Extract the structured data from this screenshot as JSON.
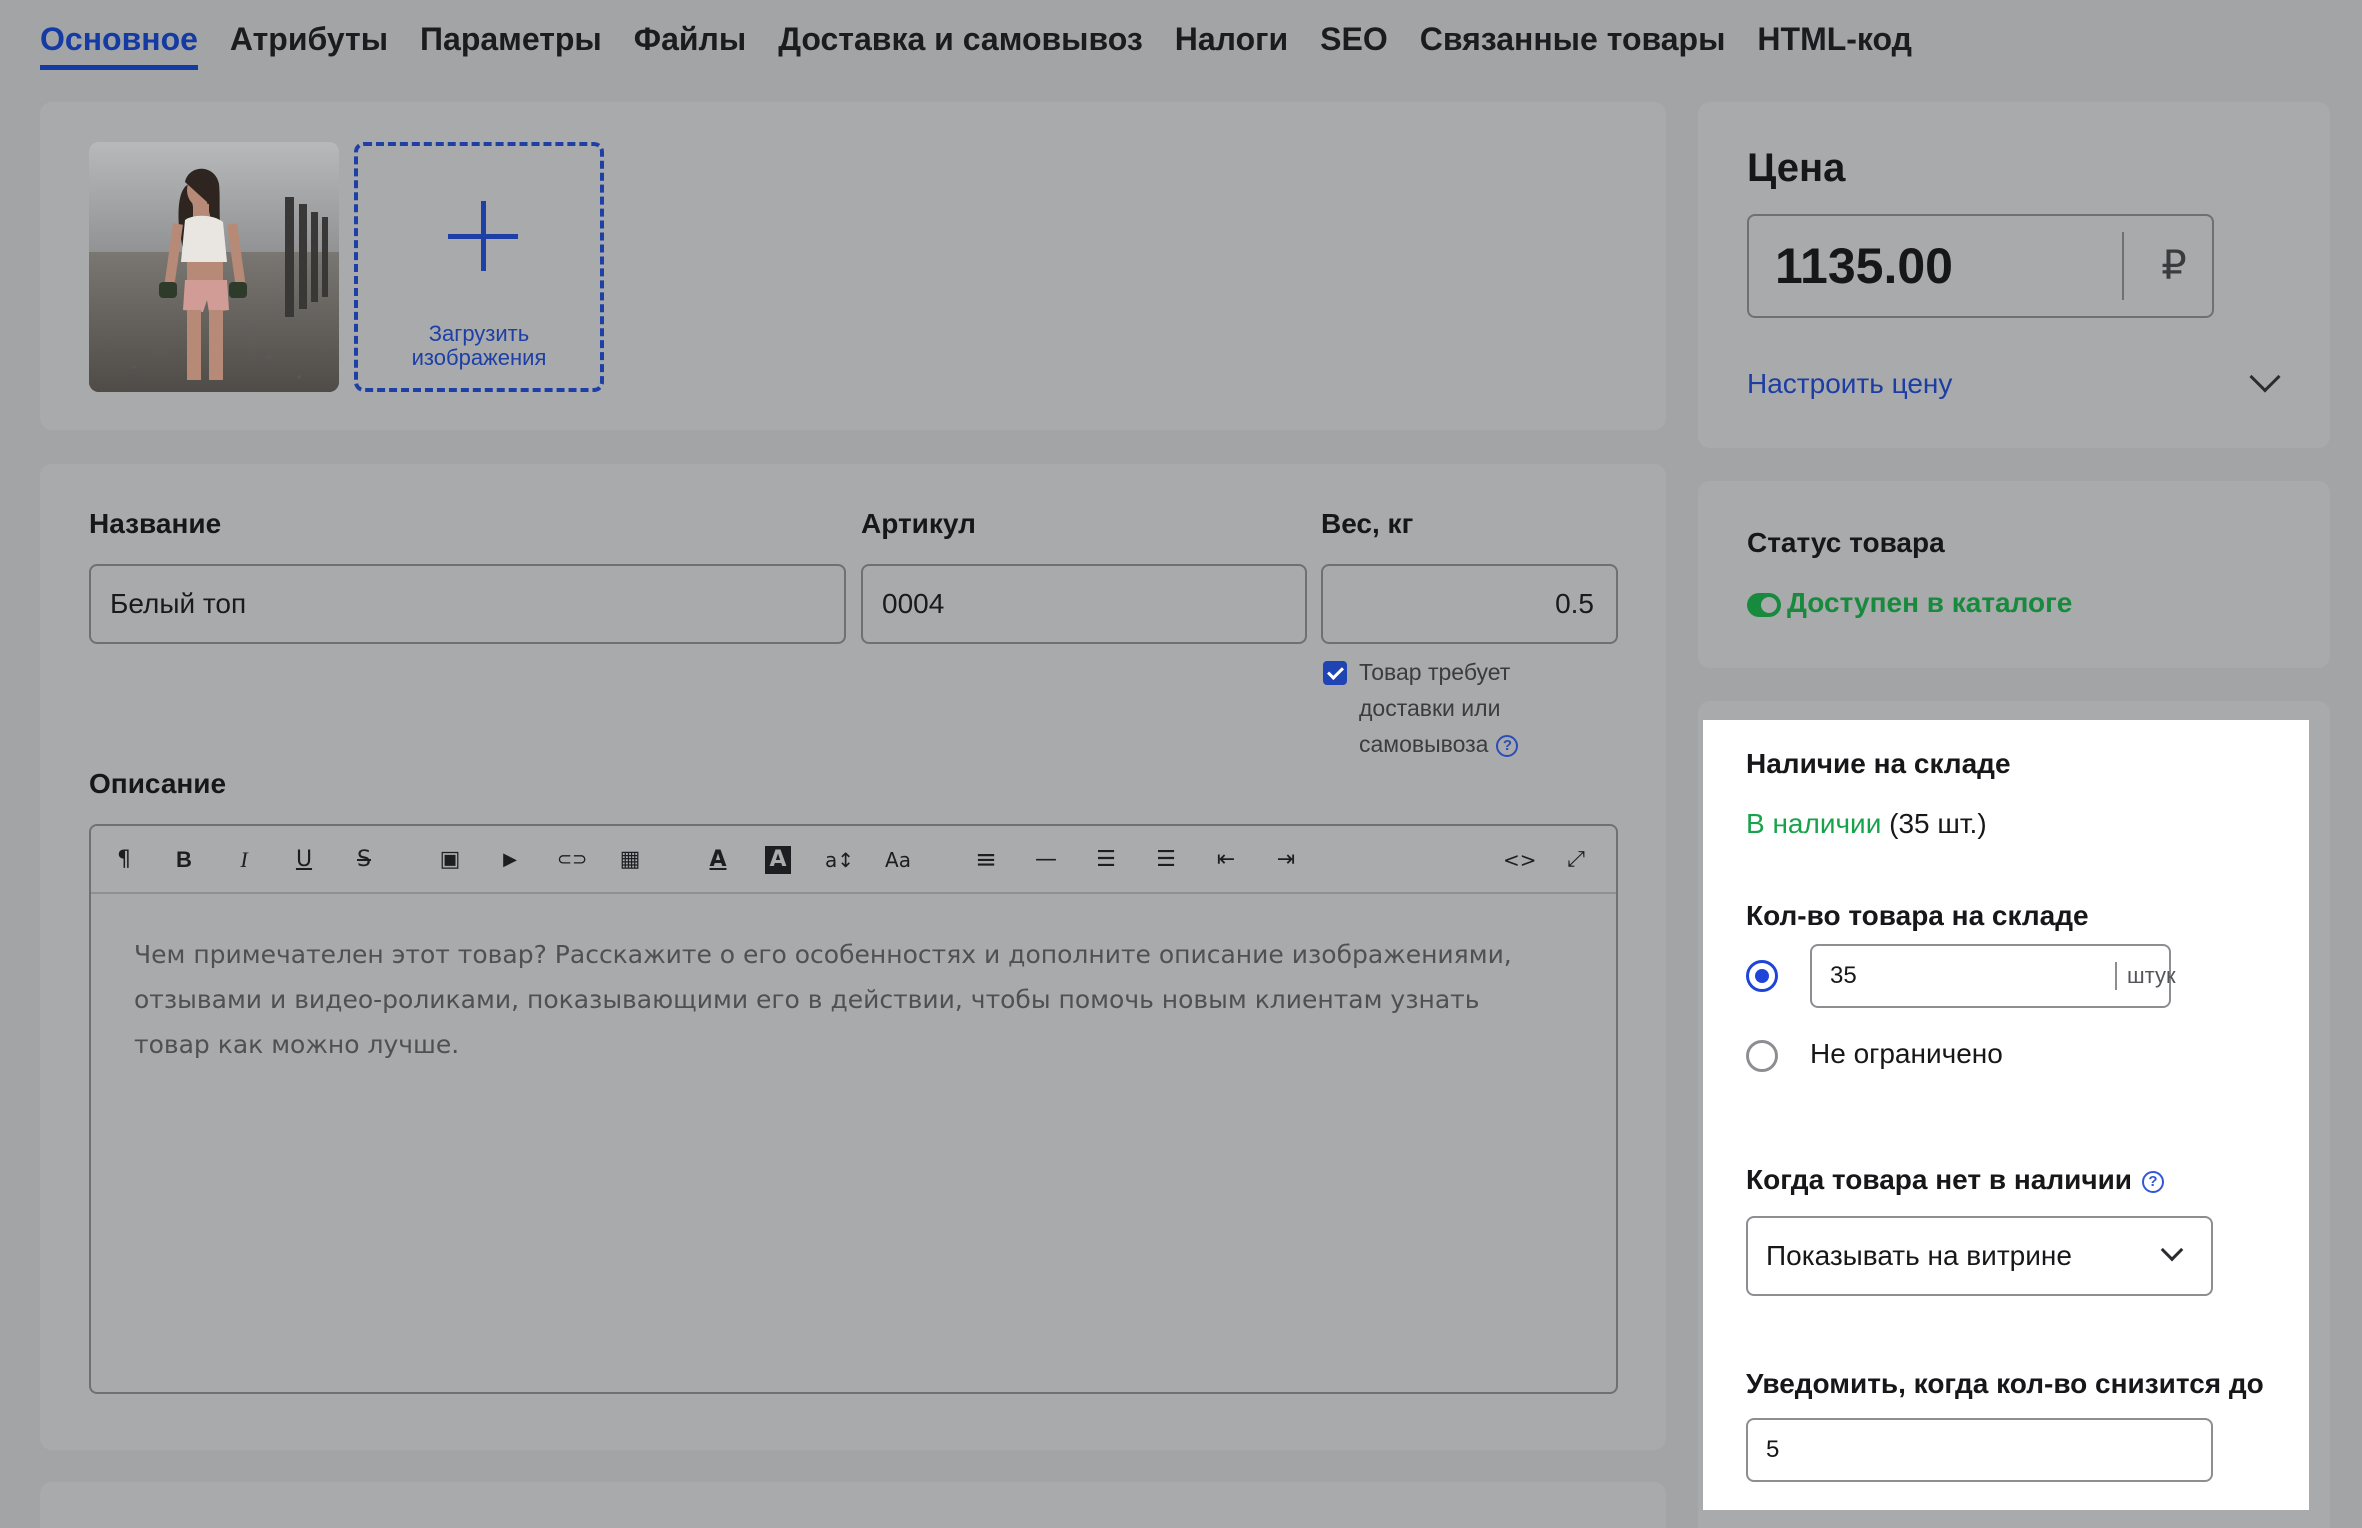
{
  "tabs": [
    {
      "label": "Основное",
      "active": true
    },
    {
      "label": "Атрибуты"
    },
    {
      "label": "Параметры"
    },
    {
      "label": "Файлы"
    },
    {
      "label": "Доставка и самовывоз"
    },
    {
      "label": "Налоги"
    },
    {
      "label": "SEO"
    },
    {
      "label": "Связанные товары"
    },
    {
      "label": "HTML-код"
    }
  ],
  "images": {
    "upload_label_line1": "Загрузить",
    "upload_label_line2": "изображения"
  },
  "fields": {
    "name_label": "Название",
    "name_value": "Белый топ",
    "sku_label": "Артикул",
    "sku_value": "0004",
    "weight_label": "Вес, кг",
    "weight_value": "0.5",
    "requires_delivery_line1": "Товар требует",
    "requires_delivery_line2": "доставки или",
    "requires_delivery_line3": "самовывоза",
    "requires_delivery_checked": true
  },
  "description": {
    "label": "Описание",
    "placeholder": "Чем примечателен этот товар? Расскажите о его особенностях и дополните описание изображениями, отзывами и видео-роликами, показывающими его в действии, чтобы помочь новым клиентам узнать товар как можно лучше."
  },
  "toolbar": [
    {
      "icon": "paragraph-icon",
      "glyph": "¶"
    },
    {
      "icon": "bold-icon",
      "glyph": "B"
    },
    {
      "icon": "italic-icon",
      "glyph": "I"
    },
    {
      "icon": "underline-icon",
      "glyph": "U"
    },
    {
      "icon": "strikethrough-icon",
      "glyph": "S"
    },
    {
      "icon": "image-icon",
      "glyph": "▣"
    },
    {
      "icon": "video-icon",
      "glyph": "▶"
    },
    {
      "icon": "link-icon",
      "glyph": "⊂⊃"
    },
    {
      "icon": "table-icon",
      "glyph": "▦"
    },
    {
      "icon": "font-color-icon",
      "glyph": "A"
    },
    {
      "icon": "highlight-color-icon",
      "glyph": "A"
    },
    {
      "icon": "font-size-icon",
      "glyph": "a↕"
    },
    {
      "icon": "text-case-icon",
      "glyph": "Aa"
    },
    {
      "icon": "align-icon",
      "glyph": "≡"
    },
    {
      "icon": "horizontal-rule-icon",
      "glyph": "—"
    },
    {
      "icon": "bulleted-list-icon",
      "glyph": "☰"
    },
    {
      "icon": "numbered-list-icon",
      "glyph": "☰"
    },
    {
      "icon": "outdent-icon",
      "glyph": "⇤"
    },
    {
      "icon": "indent-icon",
      "glyph": "⇥"
    },
    {
      "icon": "code-view-icon",
      "glyph": "<>"
    },
    {
      "icon": "fullscreen-icon",
      "glyph": "⤢"
    }
  ],
  "price": {
    "title": "Цена",
    "value": "1135.00",
    "currency": "₽",
    "configure_link": "Настроить цену"
  },
  "status": {
    "title": "Статус товара",
    "value": "Доступен в каталоге",
    "enabled": true
  },
  "stock": {
    "title": "Наличие на складе",
    "availability": "В наличии",
    "availability_count": "(35 шт.)",
    "quantity_label": "Кол-во товара на складе",
    "quantity_value": "35",
    "quantity_unit": "штук",
    "quantity_mode": "limited",
    "unlimited_label": "Не ограничено",
    "out_of_stock_label": "Когда товара нет в наличии",
    "out_of_stock_value": "Показывать на витрине",
    "notify_label": "Уведомить, когда кол-во снизится до",
    "notify_value": "5"
  },
  "colors": {
    "accent": "#143aa3",
    "status_green": "#178a3d",
    "stock_green": "#17a34a",
    "radio_blue": "#1f45d8"
  }
}
